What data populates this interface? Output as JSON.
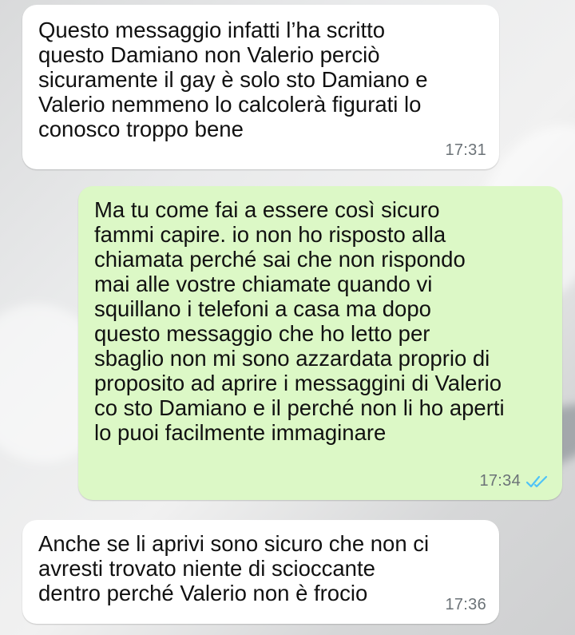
{
  "chat": {
    "messages": [
      {
        "direction": "incoming",
        "text": "Questo messaggio infatti l’ha scritto\nquesto Damiano non Valerio perciò\nsicuramente il gay è solo sto Damiano e\nValerio nemmeno lo calcolerà figurati lo\nconosco troppo bene",
        "time": "17:31"
      },
      {
        "direction": "outgoing",
        "text": "Ma tu come fai a essere così sicuro\nfammi capire. io non ho risposto alla\nchiamata perché sai che non rispondo\nmai alle vostre chiamate quando vi\nsquillano i telefoni a casa ma dopo\nquesto messaggio che ho letto per\nsbaglio non mi sono azzardata proprio di\nproposito ad aprire i messaggini di Valerio\nco sto Damiano e il perché non li ho aperti\nlo puoi facilmente immaginare",
        "time": "17:34",
        "status_icon": "double-check-read-icon"
      },
      {
        "direction": "incoming",
        "text": "Anche se li aprivi sono sicuro che non ci\navresti trovato niente di scioccante\ndentro perché Valerio non è frocio",
        "time": "17:36"
      }
    ]
  },
  "colors": {
    "incoming_bubble": "#ffffff",
    "outgoing_bubble": "#dcf8c6",
    "read_ticks": "#4fc3f7",
    "timestamp": "#6b7277"
  }
}
